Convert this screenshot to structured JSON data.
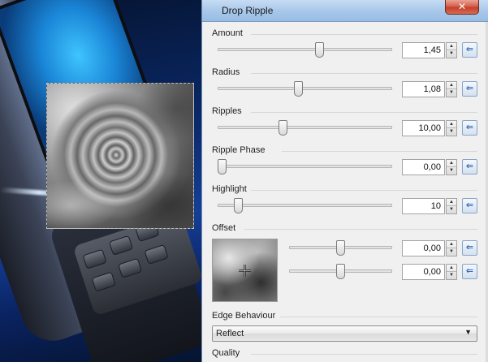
{
  "window": {
    "title": "Drop Ripple",
    "close_label": "✕"
  },
  "sliders": [
    {
      "label": "Amount",
      "value": "1,45",
      "fraction": 0.59
    },
    {
      "label": "Radius",
      "value": "1,08",
      "fraction": 0.46
    },
    {
      "label": "Ripples",
      "value": "10,00",
      "fraction": 0.37
    },
    {
      "label": "Ripple Phase",
      "value": "0,00",
      "fraction": 0.0
    },
    {
      "label": "Highlight",
      "value": "10",
      "fraction": 0.1
    }
  ],
  "offset": {
    "label": "Offset",
    "x": {
      "value": "0,00",
      "fraction": 0.5
    },
    "y": {
      "value": "0,00",
      "fraction": 0.5
    }
  },
  "edge": {
    "label": "Edge Behaviour",
    "selected": "Reflect"
  },
  "quality": {
    "label": "Quality"
  },
  "icons": {
    "reset": "reset-arrow-icon",
    "crosshair": "crosshair-icon",
    "dropdown": "chevron-down-icon",
    "spin_up": "spin-up-icon",
    "spin_down": "spin-down-icon"
  }
}
